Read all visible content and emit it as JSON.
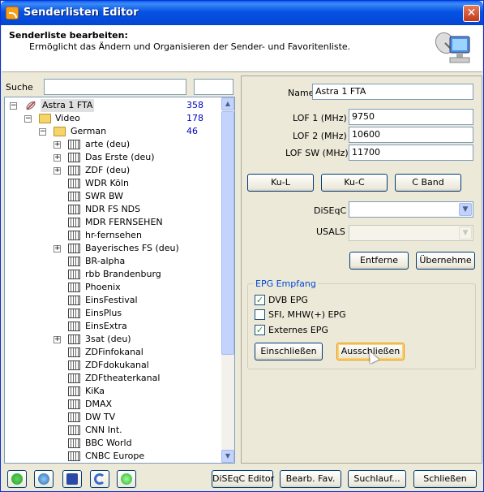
{
  "window": {
    "title": "Senderlisten Editor",
    "close_glyph": "✕"
  },
  "header": {
    "title": "Senderliste bearbeiten:",
    "subtitle": "Ermöglicht das Ändern und Organisieren der Sender- und Favoritenliste."
  },
  "search": {
    "label": "Suche",
    "value": "",
    "value2": ""
  },
  "tree": {
    "root": {
      "label": "Astra 1 FTA",
      "count": "358",
      "icon": "satellite-icon"
    },
    "video": {
      "label": "Video",
      "count": "178",
      "icon": "folder-icon"
    },
    "german": {
      "label": "German",
      "count": "46",
      "icon": "folder-icon"
    },
    "channels": [
      {
        "label": "arte (deu)",
        "expandable": true
      },
      {
        "label": "Das Erste (deu)",
        "expandable": true
      },
      {
        "label": "ZDF (deu)",
        "expandable": true
      },
      {
        "label": "WDR Köln",
        "expandable": false
      },
      {
        "label": "SWR BW",
        "expandable": false
      },
      {
        "label": "NDR FS NDS",
        "expandable": false
      },
      {
        "label": "MDR FERNSEHEN",
        "expandable": false
      },
      {
        "label": "hr-fernsehen",
        "expandable": false
      },
      {
        "label": "Bayerisches FS (deu)",
        "expandable": true
      },
      {
        "label": "BR-alpha",
        "expandable": false
      },
      {
        "label": "rbb Brandenburg",
        "expandable": false
      },
      {
        "label": "Phoenix",
        "expandable": false
      },
      {
        "label": "EinsFestival",
        "expandable": false
      },
      {
        "label": "EinsPlus",
        "expandable": false
      },
      {
        "label": "EinsExtra",
        "expandable": false
      },
      {
        "label": "3sat (deu)",
        "expandable": true
      },
      {
        "label": "ZDFinfokanal",
        "expandable": false
      },
      {
        "label": "ZDFdokukanal",
        "expandable": false
      },
      {
        "label": "ZDFtheaterkanal",
        "expandable": false
      },
      {
        "label": "KiKa",
        "expandable": false
      },
      {
        "label": "DMAX",
        "expandable": false
      },
      {
        "label": "DW TV",
        "expandable": false
      },
      {
        "label": "CNN Int.",
        "expandable": false
      },
      {
        "label": "BBC World",
        "expandable": false
      },
      {
        "label": "CNBC Europe",
        "expandable": false
      }
    ]
  },
  "details": {
    "name_label": "Name",
    "name_value": "Astra 1 FTA",
    "lof1_label": "LOF 1 (MHz)",
    "lof1_value": "9750",
    "lof2_label": "LOF 2 (MHz)",
    "lof2_value": "10600",
    "lofsw_label": "LOF SW (MHz)",
    "lofsw_value": "11700",
    "band_buttons": [
      "Ku-L",
      "Ku-C",
      "C Band"
    ],
    "diseqc_label": "DiSEqC",
    "diseqc_value": "",
    "usals_label": "USALS",
    "usals_value": "",
    "remove_button": "Entferne",
    "apply_button": "Übernehme"
  },
  "epg": {
    "group_label": "EPG Empfang",
    "options": [
      {
        "label": "DVB EPG",
        "checked": true
      },
      {
        "label": "SFI, MHW(+) EPG",
        "checked": false
      },
      {
        "label": "Externes EPG",
        "checked": true
      }
    ],
    "include_button": "Einschließen",
    "exclude_button": "Ausschließen"
  },
  "footer": {
    "icon_buttons": [
      "refresh-icon",
      "globe-icon",
      "save-icon",
      "undo-icon",
      "sync-icon"
    ],
    "diseqc_editor": "DiSEqC Editor",
    "edit_fav": "Bearb. Fav.",
    "scan": "Suchlauf...",
    "close": "Schließen"
  },
  "colors": {
    "accent": "#0054e3",
    "count": "#0000c0",
    "group_label": "#0046d5"
  }
}
